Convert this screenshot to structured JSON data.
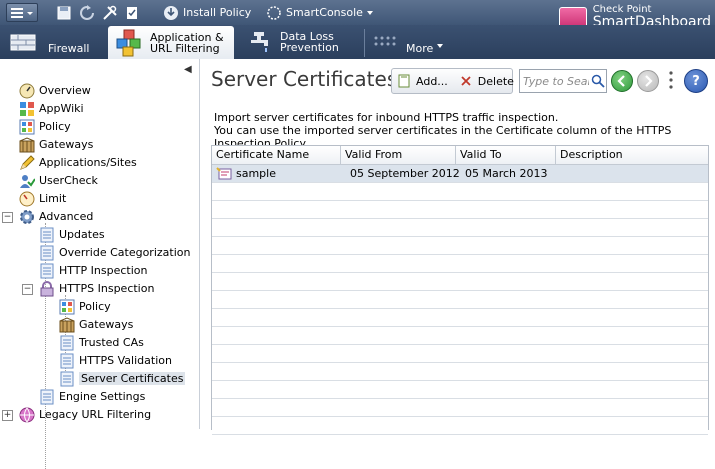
{
  "toolbar": {
    "install_policy": "Install Policy",
    "smartconsole": "SmartConsole",
    "brand_line1": "Check Point",
    "brand_line2": "SmartDashboard"
  },
  "tabs": [
    {
      "label1": "Firewall",
      "label2": ""
    },
    {
      "label1": "Application &",
      "label2": "URL Filtering"
    },
    {
      "label1": "Data Loss",
      "label2": "Prevention"
    },
    {
      "label1": "More",
      "label2": ""
    }
  ],
  "tree": {
    "items": [
      {
        "label": "Overview"
      },
      {
        "label": "AppWiki"
      },
      {
        "label": "Policy"
      },
      {
        "label": "Gateways"
      },
      {
        "label": "Applications/Sites"
      },
      {
        "label": "UserCheck"
      },
      {
        "label": "Limit"
      },
      {
        "label": "Advanced"
      },
      {
        "label": "Updates"
      },
      {
        "label": "Override Categorization"
      },
      {
        "label": "HTTP Inspection"
      },
      {
        "label": "HTTPS Inspection"
      },
      {
        "label": "Policy"
      },
      {
        "label": "Gateways"
      },
      {
        "label": "Trusted CAs"
      },
      {
        "label": "HTTPS Validation"
      },
      {
        "label": "Server Certificates"
      },
      {
        "label": "Engine Settings"
      },
      {
        "label": "Legacy URL Filtering"
      }
    ]
  },
  "main": {
    "title": "Server Certificates",
    "add_label": "Add...",
    "delete_label": "Delete",
    "search_placeholder": "Type to Search",
    "desc_line1": "Import server certificates for inbound HTTPS traffic inspection.",
    "desc_line2": "You can use the imported server certificates in the Certificate column of the HTTPS Inspection Policy.",
    "columns": [
      "Certificate Name",
      "Valid From",
      "Valid To",
      "Description"
    ],
    "rows": [
      {
        "name": "sample",
        "valid_from": "05 September 2012",
        "valid_to": "05 March 2013",
        "description": ""
      }
    ]
  },
  "colors": {
    "toolbar_bg": "#4a6080",
    "selection": "#dbe3ec",
    "nav_green": "#3aa547"
  }
}
